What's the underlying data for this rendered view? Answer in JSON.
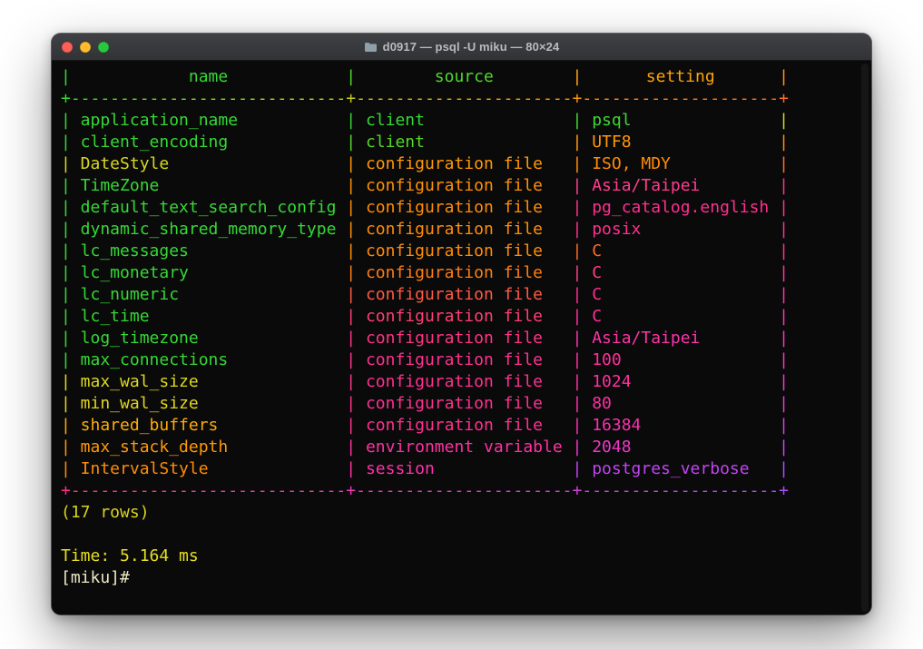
{
  "window": {
    "title": "d0917 — psql -U miku — 80×24",
    "traffic_lights": {
      "close": "#ff5f57",
      "minimize": "#febc2e",
      "zoom": "#28c840"
    }
  },
  "terminal": {
    "glyphs": {
      "pipe": "|",
      "dash": "-",
      "corner": "+"
    },
    "columns": {
      "name": 28,
      "source": 22,
      "setting": 20
    },
    "header": {
      "name": "name",
      "source": "source",
      "setting": "setting",
      "colors": [
        "#35d835",
        "#4fd82a",
        "#ffa306",
        "#ff9306"
      ]
    },
    "separator_top": {
      "colors": [
        "#35d835",
        "#b8d61a",
        "#ff9a06",
        "#ff6a24"
      ]
    },
    "separator_bottom": {
      "colors": [
        "#ff2f8a",
        "#ee36c0",
        "#a94cff"
      ]
    },
    "rows": [
      {
        "name": "application_name",
        "source": "client",
        "setting": "psql",
        "colors": [
          "#35d835",
          "#35d835",
          "#3fd830",
          "#cfd517"
        ]
      },
      {
        "name": "client_encoding",
        "source": "client",
        "setting": "UTF8",
        "colors": [
          "#35d835",
          "#55d828",
          "#ff9806",
          "#ff8a0a"
        ]
      },
      {
        "name": "DateStyle",
        "source": "configuration file",
        "setting": "ISO, MDY",
        "colors": [
          "#d8d81e",
          "#ff9806",
          "#ff8c06",
          "#ff6d1e"
        ]
      },
      {
        "name": "TimeZone",
        "source": "configuration file",
        "setting": "Asia/Taipei",
        "colors": [
          "#35d835",
          "#ff9006",
          "#ff3d90",
          "#ff2f8e"
        ]
      },
      {
        "name": "default_text_search_config",
        "source": "configuration file",
        "setting": "pg_catalog.english",
        "colors": [
          "#35d835",
          "#ff8c06",
          "#ff2f8e",
          "#ff2f93"
        ]
      },
      {
        "name": "dynamic_shared_memory_type",
        "source": "configuration file",
        "setting": "posix",
        "colors": [
          "#35d835",
          "#ff8c06",
          "#ff2f8e",
          "#ff2f98"
        ]
      },
      {
        "name": "lc_messages",
        "source": "configuration file",
        "setting": "C",
        "colors": [
          "#35d835",
          "#ff8c06",
          "#ff6a22",
          "#ff2f8e"
        ]
      },
      {
        "name": "lc_monetary",
        "source": "configuration file",
        "setting": "C",
        "colors": [
          "#35d835",
          "#ff7d12",
          "#ff3d85",
          "#ff2f9e"
        ]
      },
      {
        "name": "lc_numeric",
        "source": "configuration file",
        "setting": "C",
        "colors": [
          "#35d835",
          "#ff5a45",
          "#ff2f8e",
          "#ff2fa2"
        ]
      },
      {
        "name": "lc_time",
        "source": "configuration file",
        "setting": "C",
        "colors": [
          "#35d835",
          "#ff3f74",
          "#ff2f96",
          "#fd31ac"
        ]
      },
      {
        "name": "log_timezone",
        "source": "configuration file",
        "setting": "Asia/Taipei",
        "colors": [
          "#35d835",
          "#ff3385",
          "#fd34a8",
          "#f934b8"
        ]
      },
      {
        "name": "max_connections",
        "source": "configuration file",
        "setting": "100",
        "colors": [
          "#35d835",
          "#ff3090",
          "#ff2f9b",
          "#f434c2"
        ]
      },
      {
        "name": "max_wal_size",
        "source": "configuration file",
        "setting": "1024",
        "colors": [
          "#dcd81e",
          "#ff3090",
          "#ff2fa0",
          "#ee37cc"
        ]
      },
      {
        "name": "min_wal_size",
        "source": "configuration file",
        "setting": "80",
        "colors": [
          "#e0d41e",
          "#ff3090",
          "#ff2fa4",
          "#e639d6"
        ]
      },
      {
        "name": "shared_buffers",
        "source": "configuration file",
        "setting": "16384",
        "colors": [
          "#ffab04",
          "#ff3090",
          "#fb30ae",
          "#d83de4"
        ]
      },
      {
        "name": "max_stack_depth",
        "source": "environment variable",
        "setting": "2048",
        "colors": [
          "#ff9806",
          "#ff31a0",
          "#ef36c6",
          "#c843f0"
        ]
      },
      {
        "name": "IntervalStyle",
        "source": "session",
        "setting": "postgres_verbose",
        "colors": [
          "#ff8c06",
          "#ff31a8",
          "#c243f2",
          "#a94cff"
        ]
      }
    ],
    "footer": {
      "rows_count": "(17 rows)",
      "rows_count_color": "#d8d41e",
      "time": "Time: 5.164 ms",
      "time_color": "#e6df1f",
      "prompt": "[miku]#",
      "prompt_color": "#eae6c2"
    }
  }
}
